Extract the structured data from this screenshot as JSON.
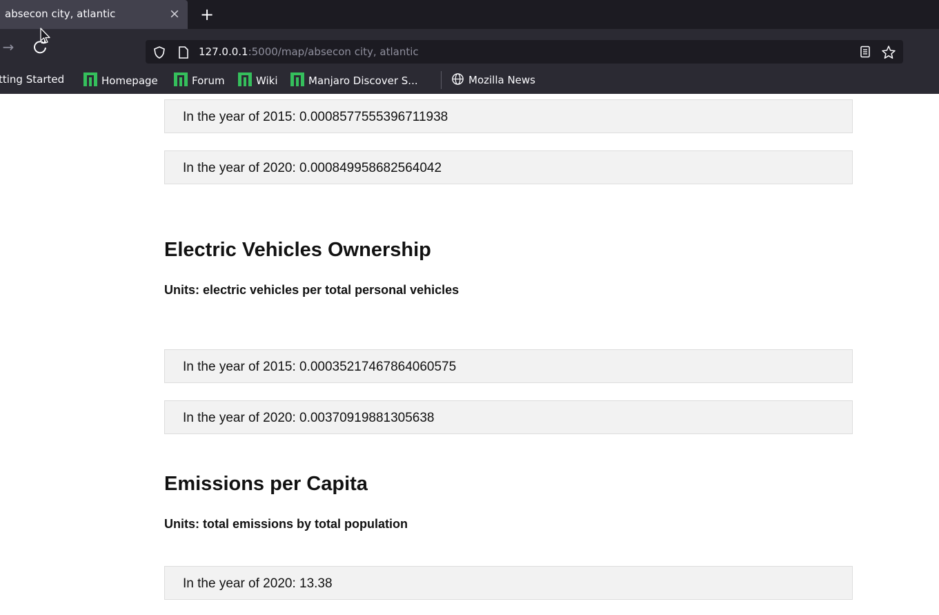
{
  "browser": {
    "tab": {
      "title": "absecon city, atlantic",
      "close": "×"
    },
    "new_tab": "+",
    "url": {
      "host": "127.0.0.1",
      "rest": ":5000/map/absecon city, atlantic"
    },
    "bookmarks": [
      {
        "label": "tting Started"
      },
      {
        "label": "Homepage"
      },
      {
        "label": "Forum"
      },
      {
        "label": "Wiki"
      },
      {
        "label": "Manjaro Discover S..."
      },
      {
        "label": "Mozilla News"
      }
    ],
    "colors": {
      "manjaro_green": "#35bf5c",
      "chrome_dark": "#1c1b22",
      "toolbar": "#2b2a33"
    }
  },
  "page": {
    "top_items": [
      {
        "text": "In the year of 2015: 0.0008577555396711938"
      },
      {
        "text": "In the year of 2020: 0.000849958682564042"
      }
    ],
    "sections": [
      {
        "title": "Electric Vehicles Ownership",
        "units": "Units: electric vehicles per total personal vehicles",
        "items": [
          {
            "text": "In the year of 2015: 0.00035217467864060575"
          },
          {
            "text": "In the year of 2020: 0.00370919881305638"
          }
        ]
      },
      {
        "title": "Emissions per Capita",
        "units": "Units: total emissions by total population",
        "items": [
          {
            "text": "In the year of 2020: 13.38"
          }
        ]
      }
    ]
  }
}
